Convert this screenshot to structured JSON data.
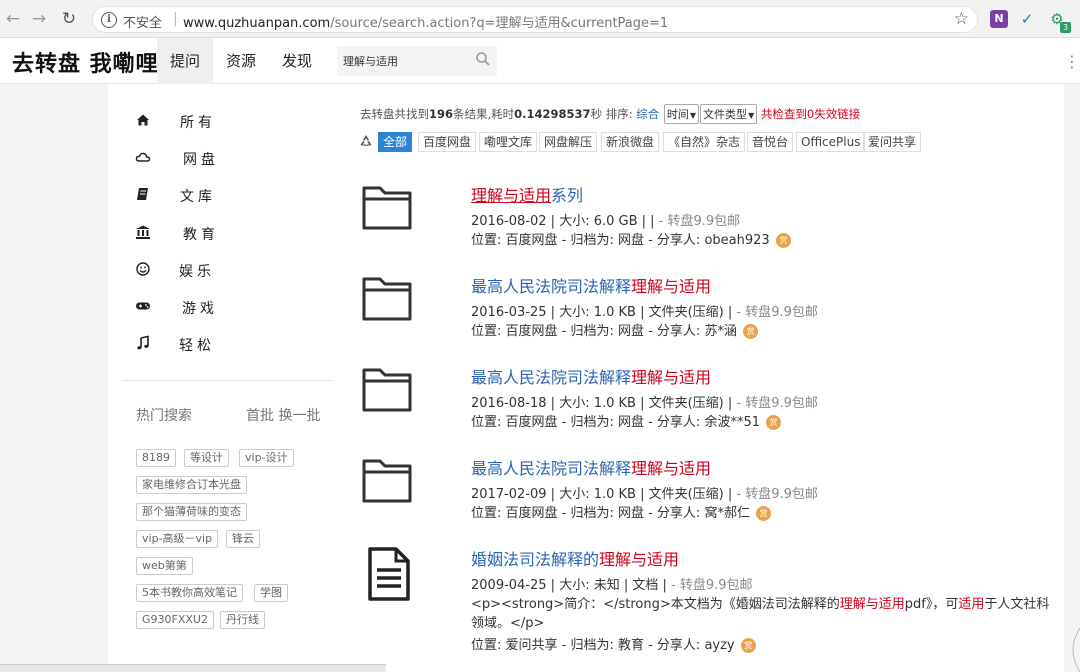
{
  "browser": {
    "insecure_label": "不安全",
    "url_host": "www.quzhuanpan.com",
    "url_path": "/source/search.action?q=理解与适用&currentPage=1",
    "ext_badge": "3"
  },
  "header": {
    "logo": "去转盘 我嘞哩",
    "nav": [
      "提问",
      "资源",
      "发现"
    ],
    "search_value": "理解与适用"
  },
  "sidebar": {
    "categories": [
      {
        "icon": "home-icon",
        "label": "所有"
      },
      {
        "icon": "cloud-icon",
        "label": "网盘"
      },
      {
        "icon": "book-icon",
        "label": "文库"
      },
      {
        "icon": "bank-icon",
        "label": "教育"
      },
      {
        "icon": "smile-icon",
        "label": "娱乐"
      },
      {
        "icon": "gamepad-icon",
        "label": "游戏"
      },
      {
        "icon": "music-icon",
        "label": "轻松"
      }
    ],
    "hot_title": "热门搜索",
    "hot_batch": "首批 换一批",
    "tags": [
      "8189",
      "等设计",
      "vip-设计",
      "家电维修合订本光盘",
      "那个猫薄荷味的变态",
      "vip-高级－vip",
      "锋云",
      "web第第",
      "5本书教你高效笔记",
      "学图",
      "G930FXXU2",
      "丹行线"
    ]
  },
  "summary": {
    "prefix": "去转盘共找到",
    "count": "196",
    "mid": "条结果,耗时",
    "time": "0.14298537",
    "suffix": "秒 排序:",
    "sort_default": "综合",
    "sort_time": "时间",
    "sort_type": "文件类型",
    "dead_links": "共检查到0失效链接"
  },
  "filters": [
    "全部",
    "百度网盘",
    "嘞哩文库",
    "网盘解压",
    "新浪微盘",
    "《自然》杂志",
    "音悦台",
    "OfficePlus",
    "爱问共享"
  ],
  "results": [
    {
      "title_plain": "",
      "title_hl": "理解与适用",
      "title_tail": "系列",
      "meta": "2016-08-02 | 大小: 6.0 GB | | ",
      "meta_grey": "- 转盘9.9包邮",
      "location": "位置: 百度网盘 - 归档为: 网盘 - 分享人: ",
      "sharer": "obeah923",
      "icon": "folder-icon"
    },
    {
      "title_plain": "最高人民法院司法解释",
      "title_hl": "理解与适用",
      "title_tail": "",
      "meta": "2016-03-25 | 大小: 1.0 KB | 文件夹(压缩) | ",
      "meta_grey": "- 转盘9.9包邮",
      "location": "位置: 百度网盘 - 归档为: 网盘 - 分享人: ",
      "sharer": "苏*涵",
      "icon": "folder-icon"
    },
    {
      "title_plain": "最高人民法院司法解释",
      "title_hl": "理解与适用",
      "title_tail": "",
      "meta": "2016-08-18 | 大小: 1.0 KB | 文件夹(压缩) | ",
      "meta_grey": "- 转盘9.9包邮",
      "location": "位置: 百度网盘 - 归档为: 网盘 - 分享人: ",
      "sharer": "余波**51",
      "icon": "folder-icon"
    },
    {
      "title_plain": "最高人民法院司法解释",
      "title_hl": "理解与适用",
      "title_tail": "",
      "meta": "2017-02-09 | 大小: 1.0 KB | 文件夹(压缩) | ",
      "meta_grey": "- 转盘9.9包邮",
      "location": "位置: 百度网盘 - 归档为: 网盘 - 分享人: ",
      "sharer": "窝*郝仁",
      "icon": "folder-icon"
    },
    {
      "title_plain": "婚姻法司法解释的",
      "title_hl": "理解与适用",
      "title_tail": "",
      "meta": "2009-04-25 | 大小: 未知 | 文档 | ",
      "meta_grey": "- 转盘9.9包邮",
      "desc_a": "<p><strong>简介：</strong>本文档为《婚姻法司法解释的",
      "desc_hl": "理解与适用",
      "desc_b": "pdf》，可",
      "desc_hl2": "适用",
      "desc_c": "于人文社科领域。</p>",
      "location": "位置: 爱问共享 - 归档为: 教育 - 分享人: ",
      "sharer": "ayzy",
      "icon": "document-icon"
    }
  ],
  "badge_label": "赏",
  "colors": {
    "link": "#2a64b4",
    "highlight": "#d0021b",
    "chip_active": "#2d83d4",
    "badge": "#e8a34c"
  }
}
